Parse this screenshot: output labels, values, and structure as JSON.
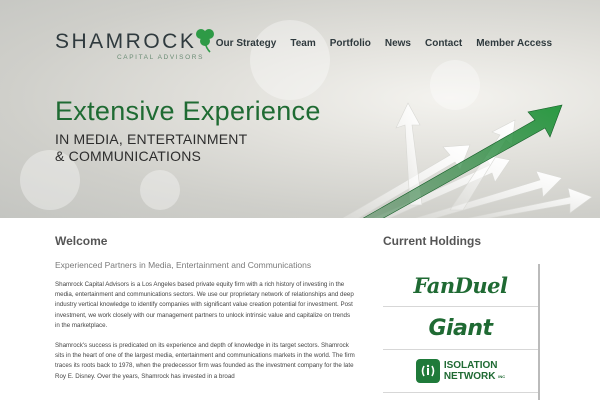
{
  "brand": {
    "name": "SHAMROCK",
    "tagline": "CAPITAL ADVISORS"
  },
  "nav": {
    "items": [
      "Our Strategy",
      "Team",
      "Portfolio",
      "News",
      "Contact",
      "Member Access"
    ]
  },
  "hero": {
    "headline": "Extensive Experience",
    "subline_1": "IN MEDIA, ENTERTAINMENT",
    "subline_2": "& COMMUNICATIONS"
  },
  "welcome": {
    "title": "Welcome",
    "subtitle": "Experienced Partners in Media, Entertainment and Communications",
    "paragraph_1": "Shamrock Capital Advisors is a Los Angeles based private equity firm with a rich history of investing in the media, entertainment and communications sectors. We use our proprietary network of relationships and deep industry vertical knowledge to identify companies with significant value creation potential for investment.  Post investment, we work closely with our management partners to unlock intrinsic value and capitalize on trends in the marketplace.",
    "paragraph_2": "Shamrock's success is predicated on its experience and depth of knowledge in its target sectors. Shamrock sits in the heart of one of the largest media, entertainment and communications markets in the world.  The firm traces its roots back to 1978, when the predecessor firm was founded as the investment company for the late Roy E. Disney.  Over the years, Shamrock has invested in a broad"
  },
  "holdings": {
    "title": "Current Holdings",
    "items": [
      {
        "name": "FanDuel"
      },
      {
        "name": "Giant"
      },
      {
        "name_line_1": "ISOLATION",
        "name_line_2": "NETWORK",
        "suffix": "INC"
      }
    ]
  },
  "colors": {
    "brand_green": "#1f6b33",
    "text_dark": "#2f3a3e"
  }
}
